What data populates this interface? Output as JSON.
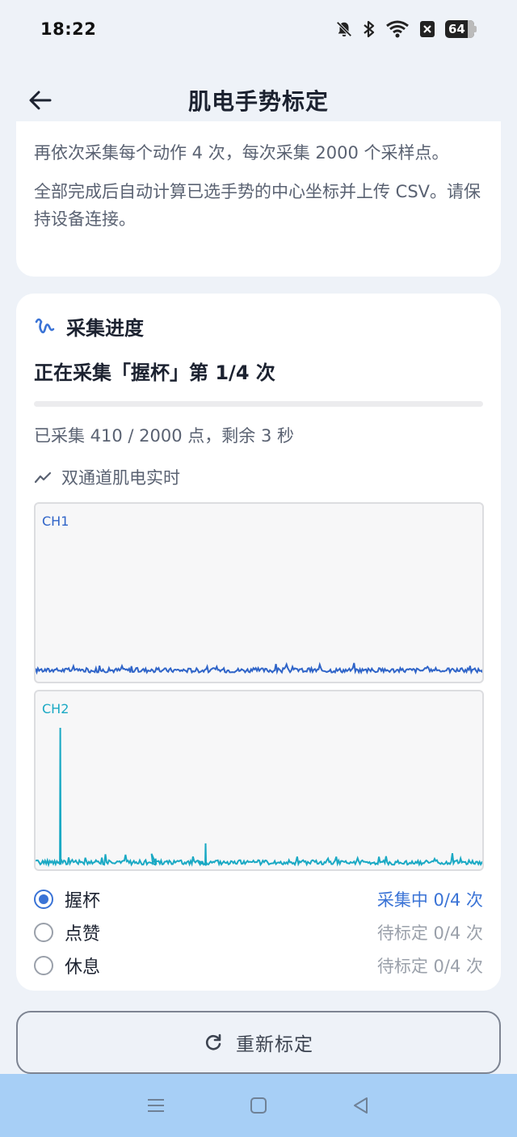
{
  "status_bar": {
    "time": "18:22",
    "battery": "64"
  },
  "header": {
    "title": "肌电手势标定"
  },
  "intro": {
    "paragraph1": "再依次采集每个动作 4 次，每次采集 2000 个采样点。",
    "paragraph2": "全部完成后自动计算已选手势的中心坐标并上传 CSV。请保持设备连接。"
  },
  "progress": {
    "section_title": "采集进度",
    "status": "正在采集「握杯」第 1/4 次",
    "fraction": 0.0,
    "count": "已采集 410 / 2000 点，剩余 3 秒",
    "chart_title": "双通道肌电实时"
  },
  "chart_data": [
    {
      "type": "line",
      "series": [
        {
          "name": "CH1",
          "color": "#2f64c8"
        }
      ],
      "baseline": 0.05,
      "noise": 0.03,
      "spikes": []
    },
    {
      "type": "line",
      "series": [
        {
          "name": "CH2",
          "color": "#1aa9c4"
        }
      ],
      "baseline": 0.02,
      "noise": 0.03,
      "spikes": [
        {
          "x": 0.055,
          "y": 0.92
        },
        {
          "x": 0.267,
          "y": 0.06
        },
        {
          "x": 0.378,
          "y": 0.16
        }
      ]
    }
  ],
  "gestures": [
    {
      "name": "握杯",
      "status": "采集中 0/4 次",
      "selected": true
    },
    {
      "name": "点赞",
      "status": "待标定 0/4 次",
      "selected": false
    },
    {
      "name": "休息",
      "status": "待标定 0/4 次",
      "selected": false
    }
  ],
  "actions": {
    "recalibrate": "重新标定"
  },
  "colors": {
    "accent": "#3a73d6",
    "ch1": "#2f64c8",
    "ch2": "#1aa9c4",
    "navbar": "#a7cff6"
  }
}
